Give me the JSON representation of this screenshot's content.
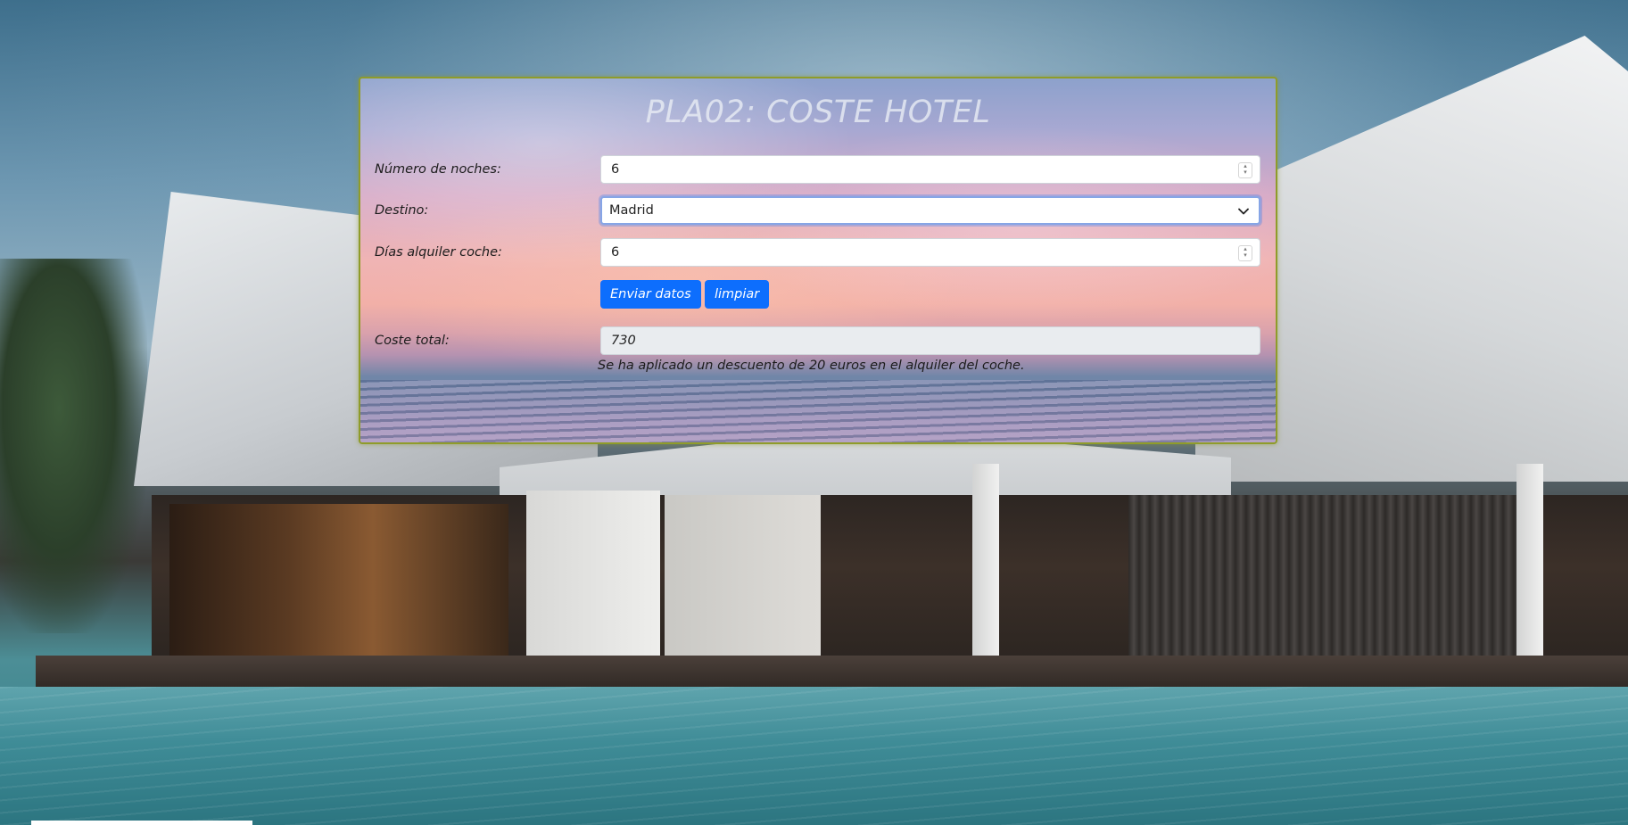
{
  "form": {
    "title": "PLA02: COSTE HOTEL",
    "nights_label": "Número de noches:",
    "nights_value": "6",
    "destination_label": "Destino:",
    "destination_value": "Madrid",
    "car_days_label": "Días alquiler coche:",
    "car_days_value": "6",
    "submit_label": "Enviar datos",
    "clear_label": "limpiar",
    "total_label": "Coste total:",
    "total_value": "730",
    "discount_note": "Se ha aplicado un descuento de 20 euros en el alquiler del coche."
  },
  "icons": {
    "spinner": "number-spinner-icon",
    "select": "chevron-down-icon"
  },
  "colors": {
    "button": "#0d6efd",
    "card_border": "#8f9c2a",
    "readonly_field": "#e9ecef"
  }
}
